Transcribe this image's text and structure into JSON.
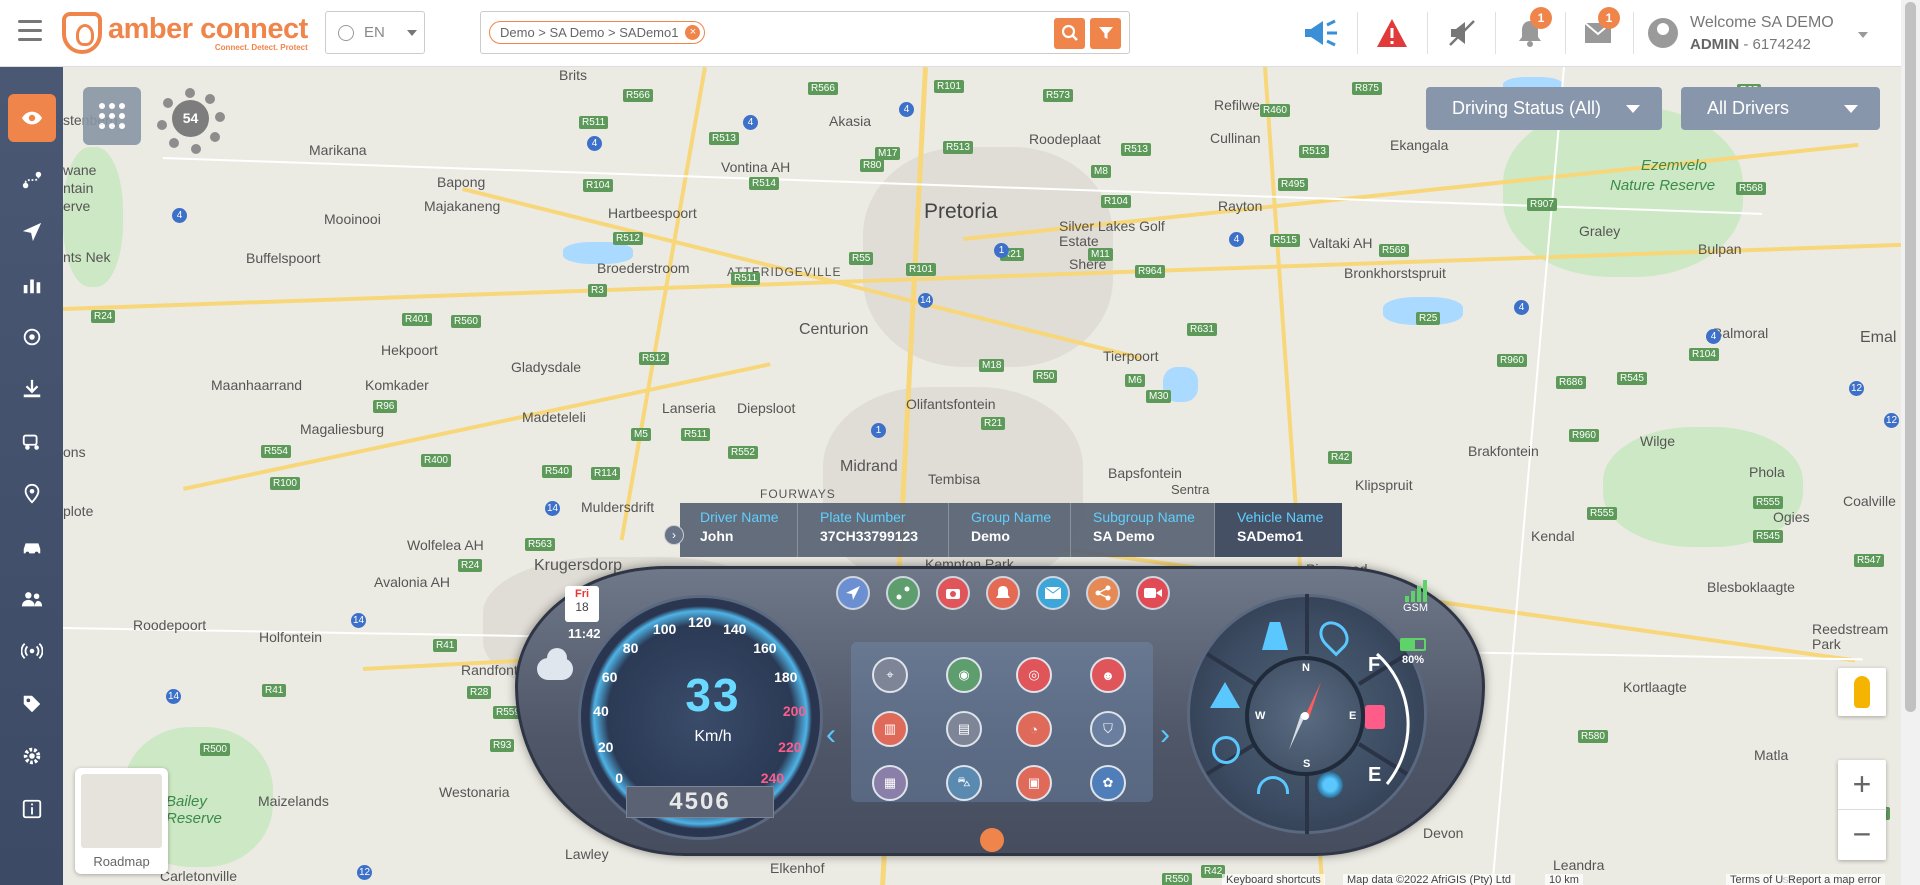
{
  "header": {
    "hamburger_icon": "menu-icon",
    "logo_name": "amber connect",
    "logo_tagline": "Connect. Detect. Protect",
    "language": "EN",
    "search_chip": "Demo > SA Demo > SADemo1",
    "search_chip_remove": "×",
    "alerts": {
      "notification_count": "1",
      "message_count": "1"
    },
    "user": {
      "welcome": "Welcome SA DEMO",
      "role": "ADMIN",
      "account": " - 6174242"
    }
  },
  "sidebar": {
    "items": [
      {
        "icon": "eye-icon",
        "active": true
      },
      {
        "icon": "route-icon"
      },
      {
        "icon": "navigate-icon"
      },
      {
        "icon": "chart-icon"
      },
      {
        "icon": "sensor-icon"
      },
      {
        "icon": "download-icon"
      },
      {
        "icon": "vehicle-service-icon"
      },
      {
        "icon": "location-pin-icon"
      },
      {
        "icon": "car-icon"
      },
      {
        "icon": "users-icon"
      },
      {
        "icon": "broadcast-icon"
      },
      {
        "icon": "tag-icon"
      },
      {
        "icon": "settings-icon"
      },
      {
        "icon": "info-icon"
      }
    ]
  },
  "map": {
    "cluster_count": "54",
    "driving_status_label": "Driving Status (All)",
    "drivers_label": "All Drivers",
    "roadmap_label": "Roadmap",
    "zoom_in": "+",
    "zoom_out": "−",
    "attribution": {
      "shortcuts": "Keyboard shortcuts",
      "data": "Map data ©2022 AfriGIS (Pty) Ltd",
      "scale": "10 km",
      "terms": "Terms of Use",
      "report": "Report a map error"
    },
    "places": {
      "pretoria": "Pretoria",
      "centurion": "Centurion",
      "midrand": "Midrand",
      "akasia": "Akasia",
      "brits": "Brits",
      "marikana": "Marikana",
      "bapong": "Bapong",
      "majakaneng": "Majakaneng",
      "mooinooi": "Mooinooi",
      "buffelspoort": "Buffelspoort",
      "nek": "nts Nek",
      "hartbeespoort": "Hartbeespoort",
      "broederstroom": "Broederstroom",
      "atteridgeville": "ATTERIDGEVILLE",
      "vontina": "Vontina AH",
      "roodeplaat": "Roodeplaat",
      "refilwe": "Refilwe",
      "cullinan": "Cullinan",
      "ekangala": "Ekangala",
      "silverlakes": "Silver Lakes Golf Estate",
      "shere": "Shere",
      "rayton": "Rayton",
      "valtaki": "Valtaki AH",
      "graley": "Graley",
      "bulpan": "Bulpan",
      "bronkhorstspruit": "Bronkhorstspruit",
      "balmoral": "Balmoral",
      "emal": "Emal",
      "hekpoort": "Hekpoort",
      "gladysdale": "Gladysdale",
      "maanhaarrand": "Maanhaarrand",
      "komkader": "Komkader",
      "magaliesburg": "Magaliesburg",
      "madeteleli": "Madeteleli",
      "lanseria": "Lanseria",
      "diepsloot": "Diepsloot",
      "olifantsfontein": "Olifantsfontein",
      "tierpoort": "Tierpoort",
      "tembisa": "Tembisa",
      "bapsfontein": "Bapsfontein",
      "fourways": "FOURWAYS",
      "muldersdrift": "Muldersdrift",
      "wolfelea": "Wolfelea AH",
      "avalonia": "Avalonia AH",
      "krugersdorp": "Krugersdorp",
      "kempton": "Kempton Park",
      "klipspruit": "Klipspruit",
      "brakfontein": "Brakfontein",
      "wilge": "Wilge",
      "phola": "Phola",
      "ogies": "Ogies",
      "coalville": "Coalville",
      "kendal": "Kendal",
      "pinewood": "Pinewood",
      "blesboklaagte": "Blesboklaagte",
      "reedstream": "Reedstream Park",
      "kortlaagte": "Kortlaagte",
      "matla": "Matla",
      "devon": "Devon",
      "leandra": "Leandra",
      "roodepoort": "Roodepoort",
      "holfontein": "Holfontein",
      "randfontein": "Randfontein",
      "maizelands": "Maizelands",
      "westonaria": "Westonaria",
      "lawley": "Lawley",
      "carletonville": "Carletonville",
      "elkenhof": "Elkenhof",
      "bailey": "Bailey",
      "reserve": "Reserve",
      "ezemvelo": "Ezemvelo",
      "naturereserve": "Nature Reserve",
      "stenberg": "stenberg",
      "wane": "wane",
      "ntain": "ntain",
      "erve": "erve",
      "ons": "ons",
      "plote": "plote",
      "sentra": "Sentra"
    }
  },
  "vehicle": {
    "driver_label": "Driver Name",
    "driver": "John",
    "plate_label": "Plate Number",
    "plate": "37CH33799123",
    "group_label": "Group Name",
    "group": "Demo",
    "subgroup_label": "Subgroup Name",
    "subgroup": "SA Demo",
    "vehicle_label": "Vehicle Name",
    "vehicle": "SADemo1"
  },
  "dashboard": {
    "day": "Fri",
    "date": "18",
    "time": "11:42",
    "speed": "33",
    "speed_unit": "Km/h",
    "odometer": "4506",
    "speed_ticks": [
      "0",
      "20",
      "40",
      "60",
      "80",
      "100",
      "120",
      "140",
      "160",
      "180",
      "200",
      "220",
      "240"
    ],
    "gsm_label": "GSM",
    "battery": "80%",
    "fuel_full": "F",
    "fuel_empty": "E",
    "compass": {
      "n": "N",
      "s": "S",
      "e": "E",
      "w": "W"
    },
    "top_icons": [
      "navigate-icon",
      "route-icon",
      "camera-icon",
      "alert-icon",
      "email-icon",
      "share-icon",
      "video-icon"
    ],
    "panel_icons": [
      "pin-icon",
      "location-icon",
      "geofence-icon",
      "driver-icon",
      "report-icon",
      "history-icon",
      "speedometer-icon",
      "shield-icon",
      "document-icon",
      "car-icon",
      "badge-icon",
      "safety-icon"
    ]
  }
}
